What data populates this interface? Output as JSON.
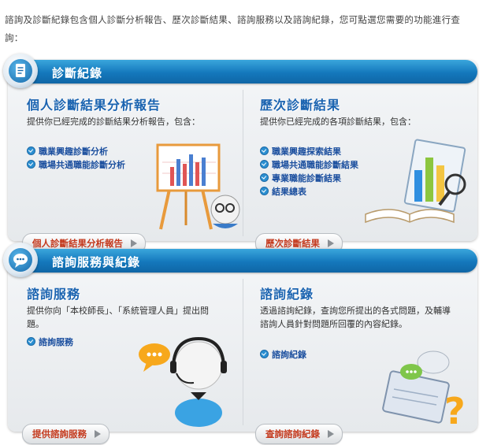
{
  "intro_text": "諮詢及診斷紀錄包含個人診斷分析報告、歷次診斷結果、諮詢服務以及諮詢紀錄，您可點選您需要的功能進行查詢：",
  "sections": [
    {
      "title": "診斷紀錄",
      "cards": [
        {
          "title": "個人診斷結果分析報告",
          "desc": "提供你已經完成的診斷結果分析報告，包含：",
          "links": [
            "職業興趣診斷分析",
            "職場共通職能診斷分析"
          ],
          "button": "個人診斷結果分析報告"
        },
        {
          "title": "歷次診斷結果",
          "desc": "提供你已經完成的各項診斷結果，包含：",
          "links": [
            "職業興趣探索結果",
            "職場共通職能診斷結果",
            "專業職能診斷結果",
            "結果總表"
          ],
          "button": "歷次診斷結果"
        }
      ]
    },
    {
      "title": "諮詢服務與紀錄",
      "cards": [
        {
          "title": "諮詢服務",
          "desc": "提供你向「本校師長」、「系統管理人員」提出問題。",
          "links": [
            "諮詢服務"
          ],
          "button": "提供諮詢服務"
        },
        {
          "title": "諮詢紀錄",
          "desc": "透過諮詢紀錄，查詢您所提出的各式問題，及輔導諮詢人員針對問題所回覆的內容紀錄。",
          "links": [
            "諮詢紀錄"
          ],
          "button": "查詢諮詢紀錄"
        }
      ]
    }
  ],
  "colors": {
    "header_bar": "#1478bc",
    "card_title": "#1a63b0",
    "link": "#1a4e9e",
    "button_text": "#c43a1e"
  },
  "icons": {
    "section1_badge": "document-icon",
    "section2_badge": "chat-icon"
  }
}
